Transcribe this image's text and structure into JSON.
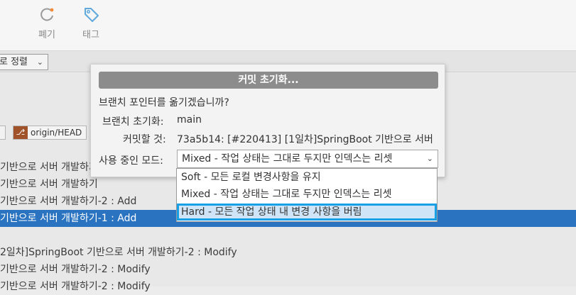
{
  "toolbar": {
    "discard_label": "폐기",
    "tag_label": "태그"
  },
  "subbar": {
    "sort_label": "로 정렬"
  },
  "log": {
    "refs": {
      "remote_label": "origin/HEAD"
    },
    "rows": [
      "기반으로 서버 개발하기",
      "기반으로 서버 개발하기",
      "기반으로 서버 개발하기-2 : Add",
      "기반으로 서버 개발하기-1 : Add",
      "2일차]SpringBoot 기반으로 서버 개발하기-2 : Modify",
      "기반으로 서버 개발하기-2 : Modify",
      "기반으로 서버 개발하기-2 : Modify"
    ]
  },
  "dialog": {
    "title": "커밋 초기화...",
    "question": "브랜치 포인터를 옮기겠습니까?",
    "branch_label": "브랜치 초기화:",
    "branch_value": "main",
    "commit_label": "커밋할 것:",
    "commit_value": "73a5b14: [#220413] [1일차]SpringBoot 기반으로 서버",
    "mode_label": "사용 중인 모드:",
    "mode_selected": "Mixed - 작업 상태는 그대로 두지만 인덱스는 리셋"
  },
  "mode_options": [
    "Soft - 모든 로컬 변경사항을 유지",
    "Mixed - 작업 상태는 그대로 두지만 인덱스는 리셋",
    "Hard - 모든 작업 상태 내 변경 사항을 버림"
  ],
  "colors": {
    "selection": "#2a73c1",
    "dialog_title_bg": "#8c8c8c",
    "option_highlight_border": "#18a0e6",
    "option_highlight_bg": "#cfe5f7"
  }
}
